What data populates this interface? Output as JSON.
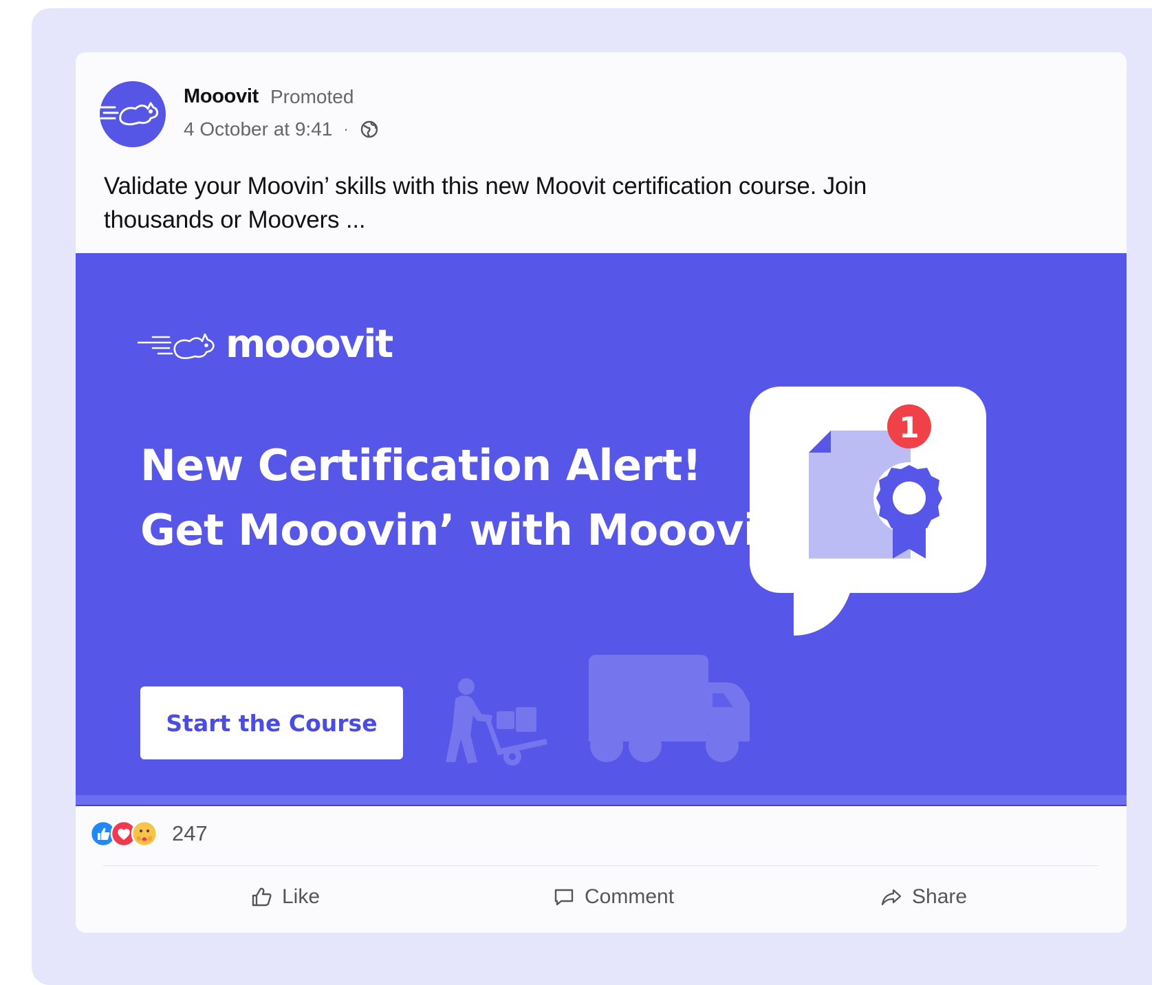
{
  "post": {
    "author": "Mooovit",
    "sponsored_label": "Promoted",
    "timestamp": "4 October at 9:41",
    "separator": "·",
    "audience_icon": "globe-icon",
    "text": "Validate your Moovin’ skills with this new Moovit certification course. Join thousands or Moovers ..."
  },
  "creative": {
    "logo_text": "mooovit",
    "headline_line1": "New Certification Alert!",
    "headline_line2": "Get Mooovin’ with Mooovit",
    "cta_label": "Start the Course",
    "badge_count": "1",
    "background_color": "#5656e8"
  },
  "engagement": {
    "reaction_icons": [
      "like-reaction-icon",
      "love-reaction-icon",
      "care-reaction-icon"
    ],
    "reaction_count": "247"
  },
  "actions": {
    "like_label": "Like",
    "comment_label": "Comment",
    "share_label": "Share"
  }
}
